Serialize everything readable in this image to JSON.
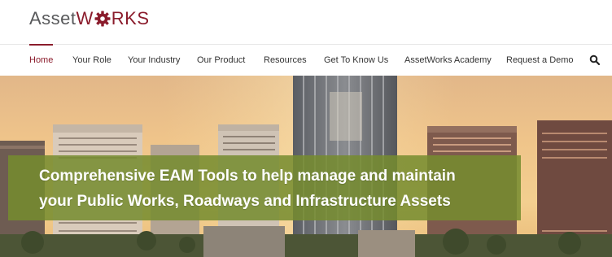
{
  "brand": {
    "logo_prefix": "Asset",
    "logo_mid": "W",
    "logo_suffix": "RKS",
    "accent_color": "#8b1c2c"
  },
  "nav": {
    "items": [
      {
        "label": "Home",
        "active": true
      },
      {
        "label": "Your Role"
      },
      {
        "label": "Your Industry"
      },
      {
        "label": "Our Product"
      },
      {
        "label": "Resources"
      },
      {
        "label": "Get To Know Us"
      },
      {
        "label": "AssetWorks Academy"
      },
      {
        "label": "Request a Demo"
      }
    ],
    "search_icon": "search-icon"
  },
  "hero": {
    "headline_line1": "Comprehensive EAM Tools to help manage and maintain",
    "headline_line2": "your Public Works, Roadways and Infrastructure Assets",
    "banner_color": "#768c2e"
  }
}
